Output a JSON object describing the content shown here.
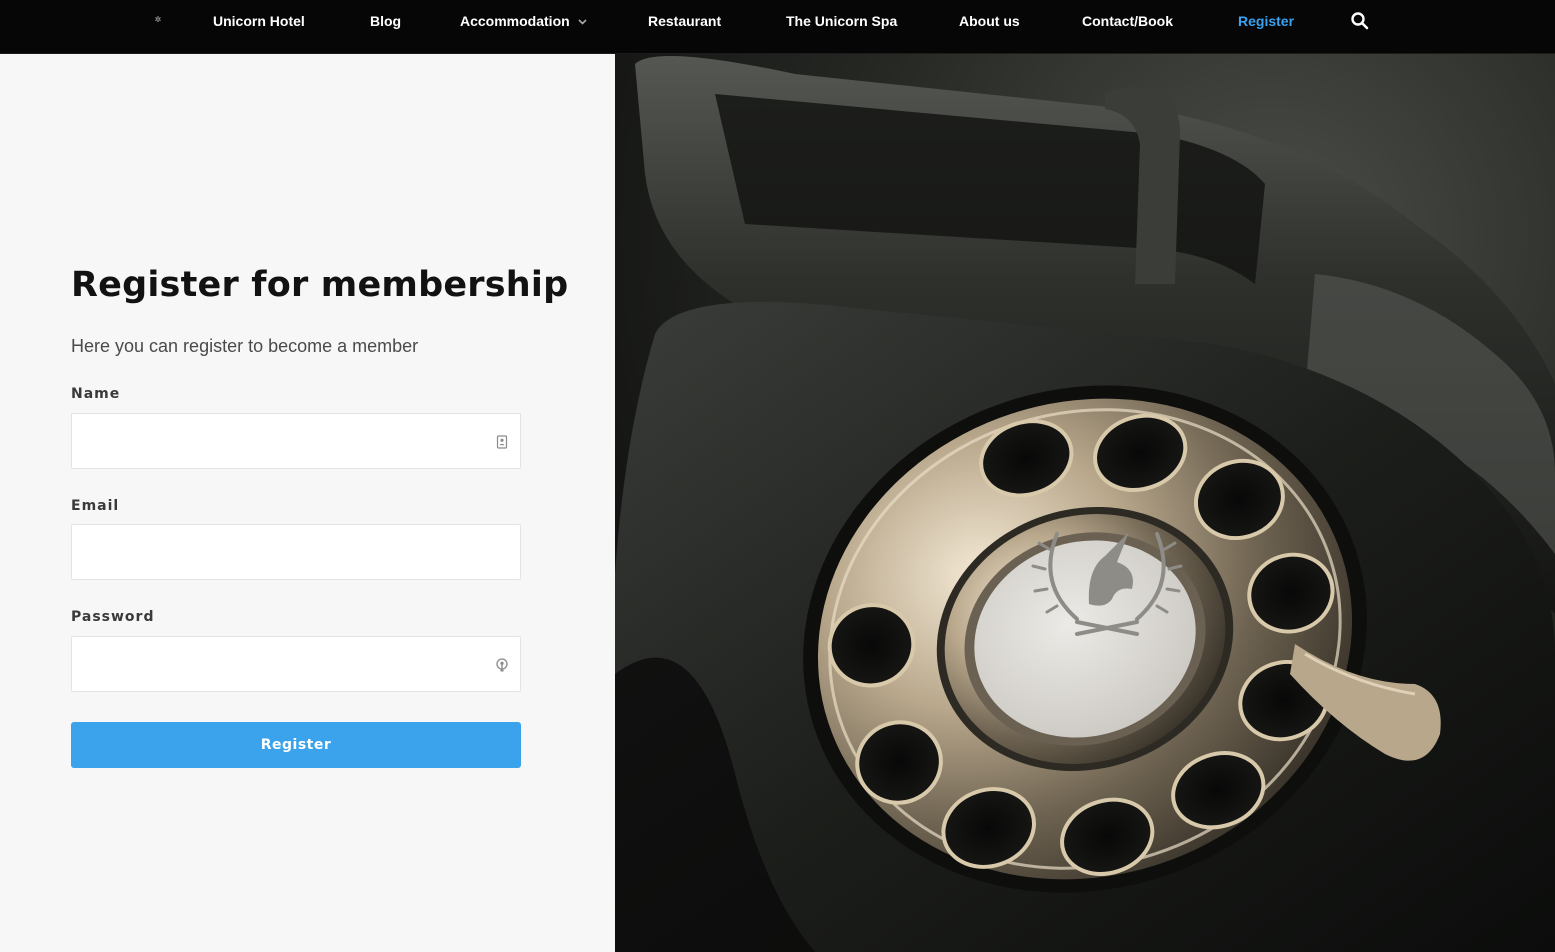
{
  "nav": {
    "logo_icon": "unicorn-logo-icon",
    "items": [
      {
        "label": "Unicorn Hotel"
      },
      {
        "label": "Blog"
      },
      {
        "label": "Accommodation"
      },
      {
        "label": "Restaurant"
      },
      {
        "label": "The Unicorn Spa"
      },
      {
        "label": "About us"
      },
      {
        "label": "Contact/Book"
      },
      {
        "label": "Register"
      }
    ],
    "active_item": "Register",
    "search_icon": "search-icon",
    "dropdown_icon": "chevron-down-icon"
  },
  "form": {
    "title": "Register for membership",
    "subtitle": "Here you can register to become a member",
    "name": {
      "label": "Name",
      "value": "",
      "icon": "contact-card-icon"
    },
    "email": {
      "label": "Email",
      "value": ""
    },
    "password": {
      "label": "Password",
      "value": "",
      "icon": "password-key-icon"
    },
    "submit_label": "Register"
  },
  "hero": {
    "image": "vintage-rotary-telephone-photo",
    "dial_emblem": "unicorn-laurel-emblem"
  },
  "colors": {
    "nav_bg": "#060606",
    "nav_text": "#ffffff",
    "accent": "#3aa3ec",
    "page_bg": "#f7f7f7",
    "title": "#121212"
  }
}
